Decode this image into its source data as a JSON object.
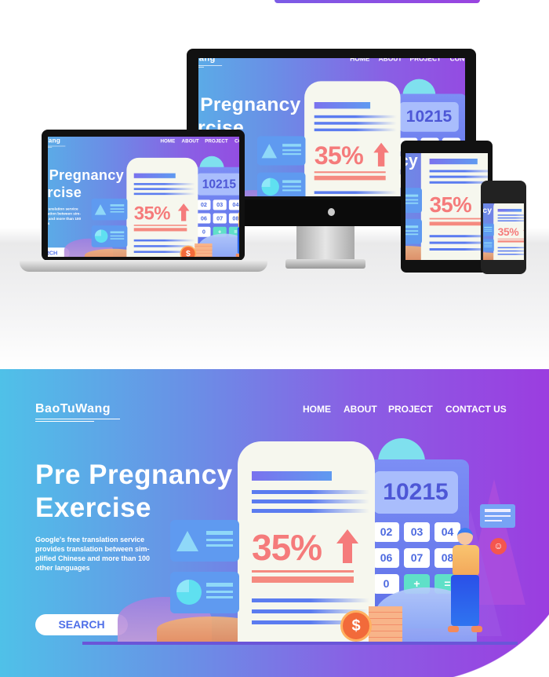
{
  "hero": {
    "logo": "BaoTuWang",
    "nav": [
      "HOME",
      "ABOUT",
      "PROJECT",
      "CONTACT US"
    ],
    "title_line1": "Pre Pregnancy",
    "title_line2": "Exercise",
    "description": "Google's free translation service provides translation between sim-plified Chinese and more than 100 other languages",
    "search_label": "SEARCH",
    "illustration": {
      "display_value": "10215",
      "keys": [
        "02",
        "03",
        "04",
        "06",
        "07",
        "08",
        "0",
        "+",
        "="
      ],
      "percent": "35%",
      "coin_symbol": "$"
    }
  },
  "devices": [
    "monitor",
    "laptop",
    "tablet",
    "phone"
  ],
  "colors": {
    "gradient_start": "#4fc1e8",
    "gradient_end": "#9b3de0",
    "accent_red": "#f57b7b",
    "button_text": "#4f6fe8"
  }
}
